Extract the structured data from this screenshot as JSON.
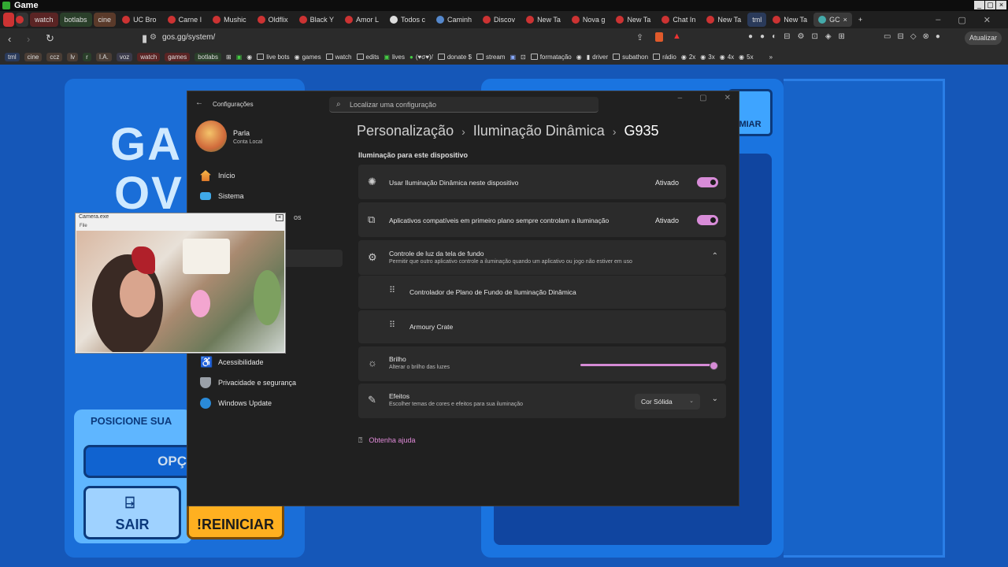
{
  "os": {
    "title": "Game",
    "controls": [
      "_",
      "▢",
      "×"
    ]
  },
  "tabs": [
    {
      "label": "watch",
      "type": "group"
    },
    {
      "label": "botlabs",
      "type": "group"
    },
    {
      "label": "cine",
      "type": "group"
    },
    {
      "label": "UC Bro",
      "type": "tab"
    },
    {
      "label": "Carne I",
      "type": "tab"
    },
    {
      "label": "Mushic",
      "type": "tab"
    },
    {
      "label": "Oldflix",
      "type": "tab"
    },
    {
      "label": "Black Y",
      "type": "tab"
    },
    {
      "label": "Amor L",
      "type": "tab"
    },
    {
      "label": "Todos c",
      "type": "tab"
    },
    {
      "label": "Caminh",
      "type": "tab"
    },
    {
      "label": "Discov",
      "type": "tab"
    },
    {
      "label": "New Ta",
      "type": "tab"
    },
    {
      "label": "Nova g",
      "type": "tab"
    },
    {
      "label": "New Ta",
      "type": "tab"
    },
    {
      "label": "Chat In",
      "type": "tab"
    },
    {
      "label": "New Ta",
      "type": "tab"
    },
    {
      "label": "tml",
      "type": "group"
    },
    {
      "label": "New Ta",
      "type": "tab"
    },
    {
      "label": "GC",
      "type": "active"
    }
  ],
  "browser": {
    "url": "gos.gg/system/",
    "update_label": "Atualizar"
  },
  "bookmarks": [
    "tml",
    "cine",
    "ccz",
    "lv",
    "r",
    "I.A.",
    "voz",
    "watch",
    "games",
    "botlabs",
    "live bots",
    "games",
    "watch",
    "edits",
    "lives",
    "(♥σ♥)/",
    "donate $",
    "stream",
    "formatação",
    "driver",
    "subathon",
    "rádio",
    "2x",
    "3x",
    "4x",
    "5x"
  ],
  "game": {
    "big_text_1": "GA",
    "big_text_2": "OV",
    "position_label": "POSICIONE SUA",
    "options_label": "OPÇ",
    "exit_label": "SAIR",
    "restart_label": "!REINICIAR",
    "right_btn_label": "MIAR"
  },
  "settings": {
    "window_title": "Configurações",
    "search_placeholder": "Localizar uma configuração",
    "user": {
      "name": "Parla",
      "type": "Conta Local"
    },
    "nav": [
      {
        "label": "Início",
        "icon": "home-icon"
      },
      {
        "label": "Sistema",
        "icon": "monitor-icon"
      },
      {
        "label": "Acessibilidade",
        "icon": "accessibility-icon"
      },
      {
        "label": "Privacidade e segurança",
        "icon": "shield-icon"
      },
      {
        "label": "Windows Update",
        "icon": "update-icon"
      }
    ],
    "hidden_nav_fragment": "os",
    "breadcrumb": [
      "Personalização",
      "Iluminação Dinâmica",
      "G935"
    ],
    "section_title": "Iluminação para este dispositivo",
    "rows": {
      "use_dynamic": {
        "label": "Usar Iluminação Dinâmica neste dispositivo",
        "state": "Ativado"
      },
      "foreground_apps": {
        "label": "Aplicativos compatíveis em primeiro plano sempre controlam a iluminação",
        "state": "Ativado"
      },
      "background_control": {
        "label": "Controle de luz da tela de fundo",
        "desc": "Permitir que outro aplicativo controle a iluminação quando um aplicativo ou jogo não estiver em uso"
      },
      "controller_1": {
        "label": "Controlador de Plano de Fundo de Iluminação Dinâmica"
      },
      "controller_2": {
        "label": "Armoury Crate"
      },
      "brightness": {
        "label": "Brilho",
        "desc": "Alterar o brilho das luzes",
        "value_fraction": 0.98
      },
      "effects": {
        "label": "Efeitos",
        "desc": "Escolher temas de cores e efeitos para sua iluminação",
        "selected": "Cor Sólida"
      }
    },
    "help_label": "Obtenha ajuda"
  },
  "camera": {
    "title": "Camera.exe",
    "menu": "File"
  },
  "colors": {
    "accent": "#d88cd8",
    "window_bg": "#202020",
    "card_bg": "#2b2b2b",
    "game_blue": "#1557b8"
  }
}
